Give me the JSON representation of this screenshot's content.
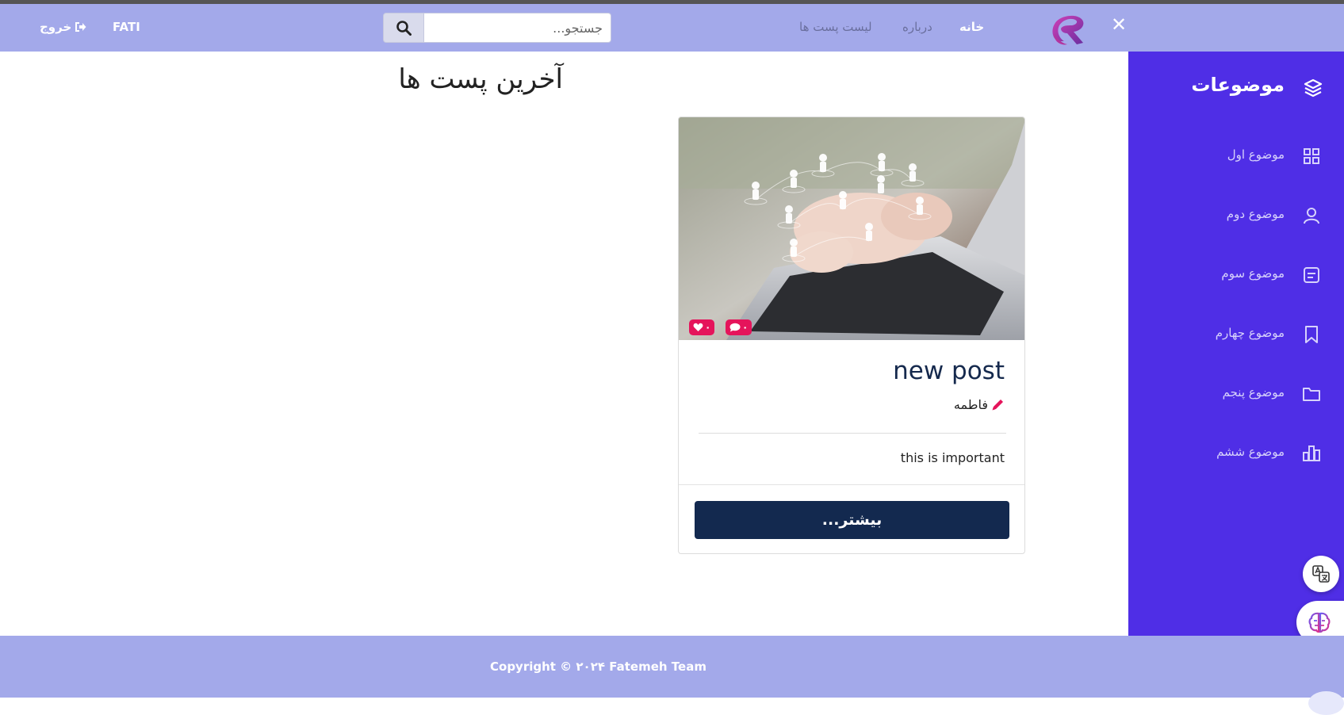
{
  "navbar": {
    "close_symbol": "✕",
    "logo_icon": "brand-r-logo-icon",
    "links": [
      {
        "label": "خانه",
        "active": true
      },
      {
        "label": "درباره",
        "active": false
      },
      {
        "label": "لیست پست ها",
        "active": false
      }
    ],
    "search": {
      "placeholder": "جستجو...",
      "value": "",
      "icon": "search-icon"
    },
    "user_name": "FATI",
    "logout_label": "خروج",
    "logout_icon": "sign-out-icon"
  },
  "sidebar": {
    "title": "موضوعات",
    "title_icon": "layers-icon",
    "items": [
      {
        "label": "موضوع اول",
        "icon": "grid-icon"
      },
      {
        "label": "موضوع دوم",
        "icon": "user-icon"
      },
      {
        "label": "موضوع سوم",
        "icon": "note-icon"
      },
      {
        "label": "موضوع چهارم",
        "icon": "bookmark-icon"
      },
      {
        "label": "موضوع پنجم",
        "icon": "folder-icon"
      },
      {
        "label": "موضوع ششم",
        "icon": "bar-chart-icon"
      }
    ]
  },
  "main": {
    "page_title": "آخرین پست ها",
    "card": {
      "likes": "۰",
      "comments": "۰",
      "title": "new post",
      "author": "فاطمه",
      "description": "this is important",
      "more_label": "بیشتر..."
    }
  },
  "footer": {
    "copyright": "Copyright © ۲۰۲۴ Fatemeh Team"
  },
  "colors": {
    "navbar_bg": "#a3a9ea",
    "sidebar_bg": "#4f2ee6",
    "button_bg": "#13294f",
    "badge_bg": "#e5145b"
  }
}
